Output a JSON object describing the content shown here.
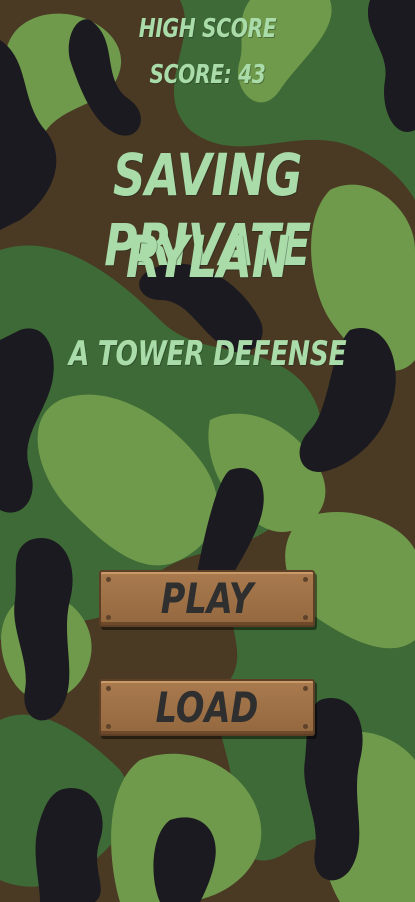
{
  "header": {
    "high_score_label": "HIGH SCORE",
    "score_text": "SCORE: 43"
  },
  "title": {
    "line1": "SAVING PRIVATE",
    "line2": "RYLAN"
  },
  "subtitle": "A TOWER DEFENSE",
  "menu": {
    "play_label": "PLAY",
    "load_label": "LOAD"
  },
  "colors": {
    "text_green": "#a9dca9",
    "camo_brown": "#4a3a24",
    "camo_dark_green": "#3d6a36",
    "camo_light_green": "#6f9a4b",
    "camo_black": "#1b1a20",
    "button_wood": "#a97a4e"
  }
}
